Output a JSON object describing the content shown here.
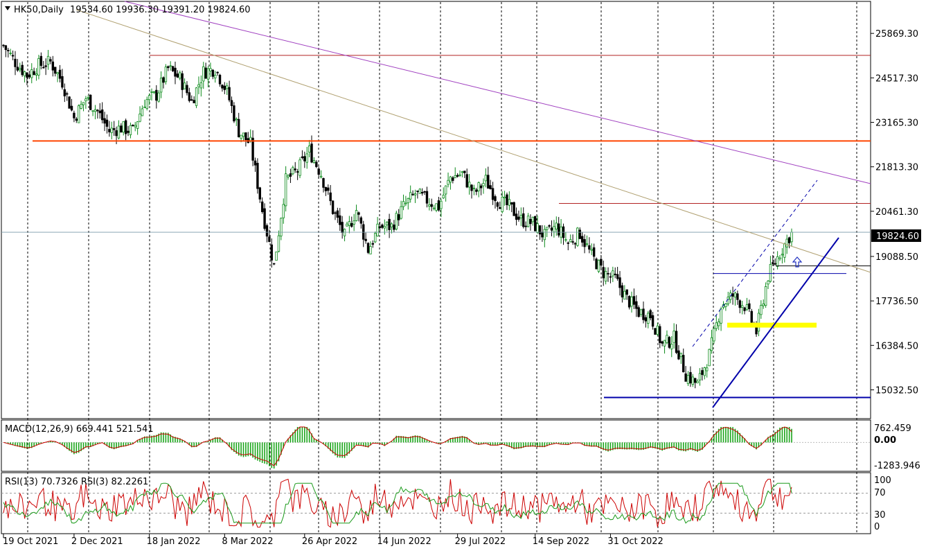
{
  "header": {
    "symbol": "HK50,Daily",
    "ohlc": "19534.60 19936.30 19391.20 19824.60"
  },
  "macd": {
    "label": "MACD(12,26,9) 669.441 521.541",
    "ticks": [
      "762.459",
      "0.00",
      "-1283.946"
    ]
  },
  "rsi": {
    "label": "RSI(13) 70.7326  RSI(3) 82.2261",
    "ticks": [
      "100",
      "70",
      "30",
      "0"
    ]
  },
  "current_price_label": "19824.60",
  "colors": {
    "bull_candle": "#0b8a1a",
    "bear_candle": "#000000",
    "resistance": "#ff4500",
    "channel": "#0000aa",
    "macd_hist": "#19a519",
    "macd_signal": "#cc0000",
    "rsi13": "#cc0000",
    "rsi3": "#1a9a1a",
    "highlight": "#ffff00",
    "trend_purple": "#a040c0",
    "trend_tan": "#b0a070"
  },
  "chart_data": {
    "type": "candlestick",
    "symbol": "HK50",
    "timeframe": "Daily",
    "last": {
      "open": 19534.6,
      "high": 19936.3,
      "low": 19391.2,
      "close": 19824.6
    },
    "y_ticks": [
      25869.3,
      24517.3,
      23165.3,
      21813.3,
      20461.3,
      19088.5,
      17736.5,
      16384.5,
      15032.5
    ],
    "x_labels": [
      "19 Oct 2021",
      "2 Dec 2021",
      "18 Jan 2022",
      "8 Mar 2022",
      "26 Apr 2022",
      "14 Jun 2022",
      "29 Jul 2022",
      "14 Sep 2022",
      "31 Oct 2022"
    ],
    "ylim": [
      14200,
      26800
    ],
    "closes": [
      [
        0,
        25500
      ],
      [
        5,
        25000
      ],
      [
        10,
        24600
      ],
      [
        15,
        24900
      ],
      [
        20,
        25000
      ],
      [
        25,
        24400
      ],
      [
        30,
        23300
      ],
      [
        35,
        23900
      ],
      [
        40,
        23500
      ],
      [
        45,
        22900
      ],
      [
        50,
        23000
      ],
      [
        55,
        22900
      ],
      [
        60,
        23800
      ],
      [
        65,
        24000
      ],
      [
        70,
        24800
      ],
      [
        75,
        24500
      ],
      [
        80,
        23800
      ],
      [
        85,
        24700
      ],
      [
        90,
        24800
      ],
      [
        95,
        24100
      ],
      [
        100,
        22900
      ],
      [
        105,
        22500
      ],
      [
        110,
        20500
      ],
      [
        115,
        18800
      ],
      [
        120,
        21400
      ],
      [
        125,
        21700
      ],
      [
        130,
        22300
      ],
      [
        135,
        21600
      ],
      [
        140,
        20500
      ],
      [
        145,
        19700
      ],
      [
        150,
        20500
      ],
      [
        155,
        19300
      ],
      [
        160,
        20000
      ],
      [
        165,
        20000
      ],
      [
        170,
        20600
      ],
      [
        175,
        21000
      ],
      [
        180,
        20800
      ],
      [
        185,
        20600
      ],
      [
        190,
        21500
      ],
      [
        195,
        21600
      ],
      [
        200,
        21000
      ],
      [
        205,
        21400
      ],
      [
        210,
        20800
      ],
      [
        215,
        20600
      ],
      [
        220,
        20200
      ],
      [
        225,
        20100
      ],
      [
        230,
        19700
      ],
      [
        235,
        20000
      ],
      [
        240,
        19500
      ],
      [
        245,
        19800
      ],
      [
        250,
        19100
      ],
      [
        255,
        18600
      ],
      [
        260,
        18400
      ],
      [
        265,
        17800
      ],
      [
        270,
        17400
      ],
      [
        275,
        17300
      ],
      [
        280,
        16400
      ],
      [
        285,
        16600
      ],
      [
        290,
        15500
      ],
      [
        295,
        15200
      ],
      [
        300,
        16100
      ],
      [
        305,
        17600
      ],
      [
        310,
        17900
      ],
      [
        315,
        17600
      ],
      [
        320,
        16800
      ],
      [
        325,
        18500
      ],
      [
        330,
        19200
      ],
      [
        335,
        19824.6
      ]
    ],
    "horizontal_levels": [
      {
        "name": "resistance_high",
        "value": 25200
      },
      {
        "name": "resistance",
        "value": 22600
      },
      {
        "name": "resistance_mid",
        "value": 20700
      },
      {
        "name": "current",
        "value": 19824.6
      },
      {
        "name": "pivot",
        "value": 18800
      },
      {
        "name": "support_zone",
        "value": 17000
      },
      {
        "name": "low_support",
        "value": 14800
      }
    ],
    "macd": {
      "macd": 669.441,
      "signal": 521.541,
      "range": [
        -1283.946,
        762.459
      ]
    },
    "rsi": {
      "rsi13": 70.7326,
      "rsi3": 82.2261,
      "levels": [
        70,
        30
      ],
      "range": [
        0,
        100
      ]
    }
  }
}
